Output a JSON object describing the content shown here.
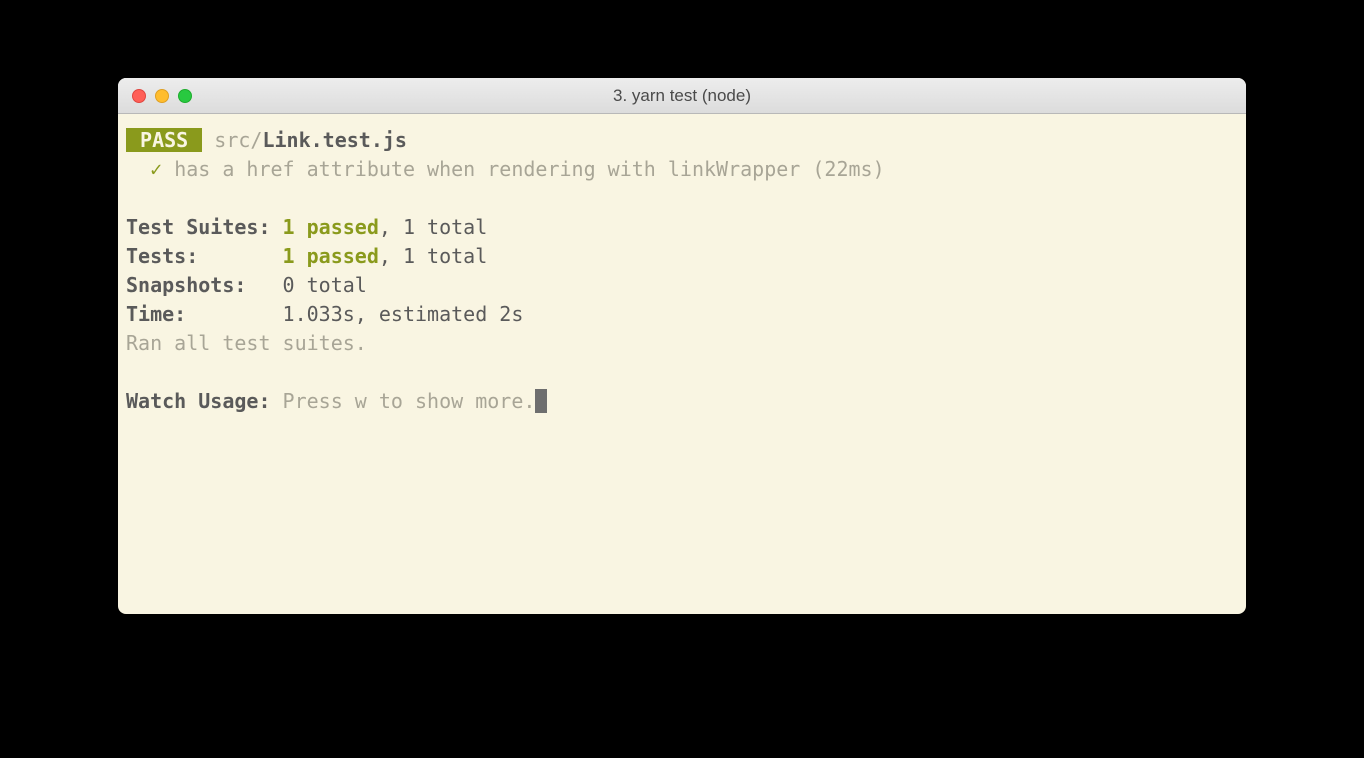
{
  "window": {
    "title": "3. yarn test (node)"
  },
  "test": {
    "badge": " PASS ",
    "path_prefix": "src/",
    "file": "Link.test.js",
    "check": "✓",
    "description": "has a href attribute when rendering with linkWrapper (22ms)"
  },
  "summary": {
    "suites_label": "Test Suites: ",
    "suites_passed": "1 passed",
    "suites_total": ", 1 total",
    "tests_label": "Tests:       ",
    "tests_passed": "1 passed",
    "tests_total": ", 1 total",
    "snapshots_label": "Snapshots:   ",
    "snapshots_value": "0 total",
    "time_label": "Time:        ",
    "time_value": "1.033s, estimated 2s",
    "ran": "Ran all test suites."
  },
  "watch": {
    "label": "Watch Usage: ",
    "hint": "Press w to show more."
  }
}
